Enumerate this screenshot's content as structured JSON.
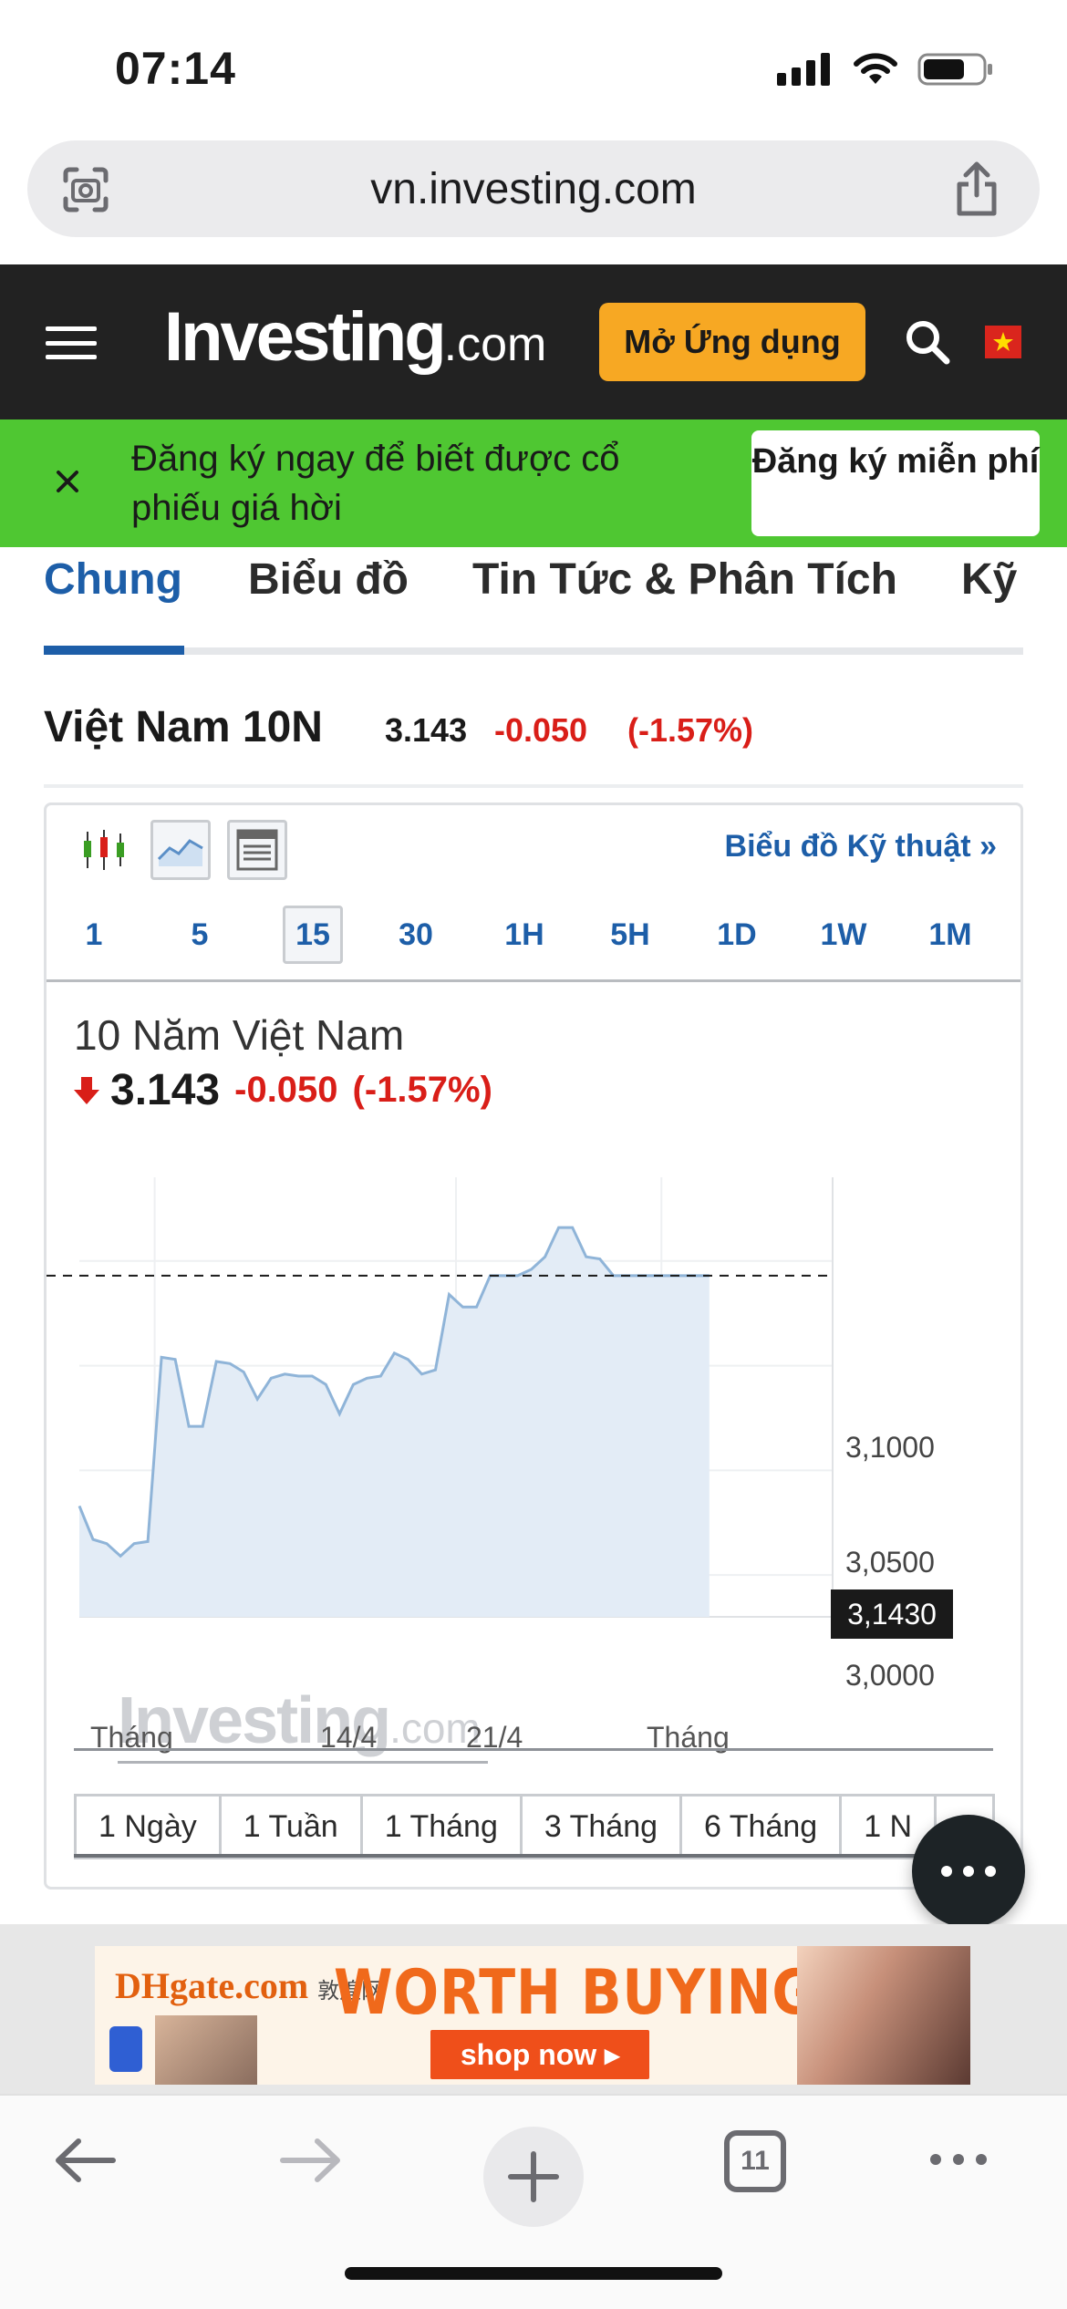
{
  "status_bar": {
    "time": "07:14"
  },
  "browser": {
    "url": "vn.investing.com",
    "tab_count": "11"
  },
  "header": {
    "logo_main": "Investing",
    "logo_suffix": ".com",
    "open_app_label": "Mở Ứng dụng"
  },
  "signup_banner": {
    "text": "Đăng ký ngay để biết được cổ phiếu giá hời",
    "button_label": "Đăng ký miễn phí"
  },
  "tabs": [
    {
      "label": "Chung",
      "active": true
    },
    {
      "label": "Biểu đồ"
    },
    {
      "label": "Tin Tức & Phân Tích"
    },
    {
      "label": "Kỹ"
    }
  ],
  "instrument": {
    "name": "Việt Nam 10N",
    "price": "3.143",
    "change": "-0.050",
    "change_pct": "(-1.57%)"
  },
  "chart_panel": {
    "technical_link": "Biểu đồ Kỹ thuật",
    "intervals": [
      "1",
      "5",
      "15",
      "30",
      "1H",
      "5H",
      "1D",
      "1W",
      "1M"
    ],
    "selected_interval": "15",
    "title": "10 Năm Việt Nam",
    "price": "3.143",
    "change": "-0.050",
    "change_pct": "(-1.57%)",
    "last_price_tag": "3,1430",
    "watermark_main": "Investing",
    "watermark_suffix": ".com",
    "ranges": [
      "1 Ngày",
      "1 Tuần",
      "1 Tháng",
      "3 Tháng",
      "6 Tháng",
      "1 N"
    ]
  },
  "chart_data": {
    "type": "area",
    "title": "10 Năm Việt Nam",
    "y_ticks": [
      "3,0000",
      "3,0500",
      "3,1000"
    ],
    "x_ticks": [
      "Tháng",
      "14/4",
      "21/4",
      "Tháng"
    ],
    "ylim": [
      2.98,
      3.19
    ],
    "last_value": 3.143,
    "colors": {
      "line": "#8fb4d8",
      "fill": "#e3ecf6",
      "last_line": "#1a1a1a"
    },
    "x": [
      0,
      1,
      2,
      3,
      4,
      5,
      6,
      7,
      8,
      9,
      10,
      11,
      12,
      13,
      14,
      15,
      16,
      17,
      18,
      19,
      20,
      21,
      22,
      23,
      24,
      25,
      26,
      27,
      28,
      29,
      30,
      31,
      32,
      33,
      34,
      35,
      36,
      37,
      38,
      39,
      40,
      41,
      42,
      43,
      44,
      45,
      46
    ],
    "values": [
      3.033,
      3.017,
      3.015,
      3.009,
      3.015,
      3.016,
      3.104,
      3.103,
      3.071,
      3.071,
      3.102,
      3.101,
      3.097,
      3.084,
      3.094,
      3.096,
      3.095,
      3.095,
      3.091,
      3.077,
      3.091,
      3.094,
      3.095,
      3.106,
      3.103,
      3.096,
      3.098,
      3.134,
      3.128,
      3.128,
      3.143,
      3.143,
      3.143,
      3.146,
      3.152,
      3.166,
      3.166,
      3.152,
      3.151,
      3.143,
      3.143,
      3.143,
      3.143,
      3.143,
      3.143,
      3.143,
      3.143
    ]
  },
  "ad": {
    "brand": "DHgate.com",
    "brand_sub": "敦煌网",
    "headline": "WORTH BUYING LIST",
    "button": "shop now ▸"
  }
}
